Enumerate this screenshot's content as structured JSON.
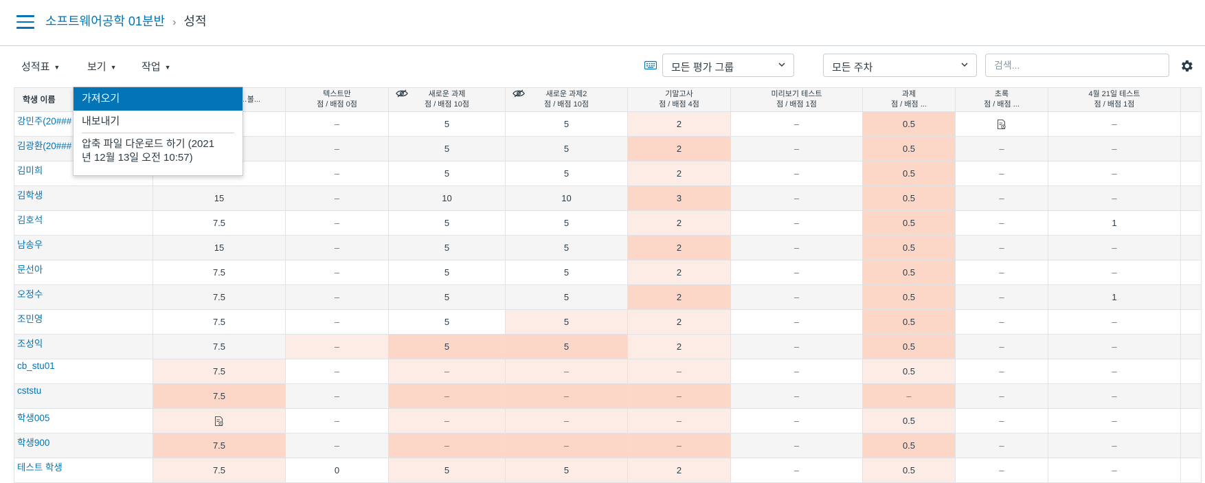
{
  "breadcrumb": {
    "course": "소프트웨어공학 01분반",
    "separator": "›",
    "page": "성적"
  },
  "toolbar": {
    "gradebook_menu": "성적표",
    "view_menu": "보기",
    "actions_menu": "작업",
    "group_select": "모든 평가 그룹",
    "period_select": "모든 주차",
    "search_placeholder": "검색..."
  },
  "actions_dropdown": {
    "import": "가져오기",
    "export": "내보내기",
    "download_line1": "압축 파일 다운로드 하기 (2021",
    "download_line2": "년 12월 13일 오전 10:57)"
  },
  "grid": {
    "name_header": "학생 이름",
    "columns": [
      {
        "title": "…볼...",
        "sub": ""
      },
      {
        "title": "텍스트만",
        "sub": "점 / 배점 0점"
      },
      {
        "title": "새로운 과제",
        "sub": "점 / 배점 10점"
      },
      {
        "title": "새로운 과제2",
        "sub": "점 / 배점 10점"
      },
      {
        "title": "기말고사",
        "sub": "점 / 배점 4점"
      },
      {
        "title": "미리보기 테스트",
        "sub": "점 / 배점 1점"
      },
      {
        "title": "과제",
        "sub": "점 / 배점 ..."
      },
      {
        "title": "초록",
        "sub": "점 / 배점 ..."
      },
      {
        "title": "4월 21일 테스트",
        "sub": "점 / 배점 1점"
      }
    ],
    "rows": [
      {
        "name": "강민주(20###",
        "cells": [
          "",
          "–",
          "5",
          "5",
          "2",
          "–",
          "0.5",
          "doc-icon",
          "–"
        ]
      },
      {
        "name": "김광환(20###",
        "cells": [
          "",
          "–",
          "5",
          "5",
          "2",
          "–",
          "0.5",
          "–",
          "–"
        ]
      },
      {
        "name": "김미희",
        "cells": [
          "",
          "–",
          "5",
          "5",
          "2",
          "–",
          "0.5",
          "–",
          "–"
        ]
      },
      {
        "name": "김학생",
        "cells": [
          "15",
          "–",
          "10",
          "10",
          "3",
          "–",
          "0.5",
          "–",
          "–"
        ]
      },
      {
        "name": "김호석",
        "cells": [
          "7.5",
          "–",
          "5",
          "5",
          "2",
          "–",
          "0.5",
          "–",
          "1"
        ]
      },
      {
        "name": "남송우",
        "cells": [
          "15",
          "–",
          "5",
          "5",
          "2",
          "–",
          "0.5",
          "–",
          "–"
        ]
      },
      {
        "name": "문선아",
        "cells": [
          "7.5",
          "–",
          "5",
          "5",
          "2",
          "–",
          "0.5",
          "–",
          "–"
        ]
      },
      {
        "name": "오정수",
        "cells": [
          "7.5",
          "–",
          "5",
          "5",
          "2",
          "–",
          "0.5",
          "–",
          "1"
        ]
      },
      {
        "name": "조민영",
        "cells": [
          "7.5",
          "–",
          "5",
          "5",
          "2",
          "–",
          "0.5",
          "–",
          "–"
        ]
      },
      {
        "name": "조성익",
        "cells": [
          "7.5",
          "–",
          "5",
          "5",
          "2",
          "–",
          "0.5",
          "–",
          "–"
        ]
      },
      {
        "name": "cb_stu01",
        "cells": [
          "7.5",
          "–",
          "–",
          "–",
          "–",
          "–",
          "0.5",
          "–",
          "–"
        ]
      },
      {
        "name": "cststu",
        "cells": [
          "7.5",
          "–",
          "–",
          "–",
          "–",
          "–",
          "–",
          "–",
          "–"
        ]
      },
      {
        "name": "학생005",
        "cells": [
          "doc-icon",
          "–",
          "–",
          "–",
          "–",
          "–",
          "0.5",
          "–",
          "–"
        ]
      },
      {
        "name": "학생900",
        "cells": [
          "7.5",
          "–",
          "–",
          "–",
          "–",
          "–",
          "0.5",
          "–",
          "–"
        ]
      },
      {
        "name": "테스트 학생",
        "cells": [
          "7.5",
          "0",
          "5",
          "5",
          "2",
          "–",
          "0.5",
          "–",
          "–"
        ]
      }
    ]
  },
  "colors": {
    "link": "#0374b5",
    "highlight_light": "#fdece6",
    "highlight_strong": "#fcd7c8"
  }
}
